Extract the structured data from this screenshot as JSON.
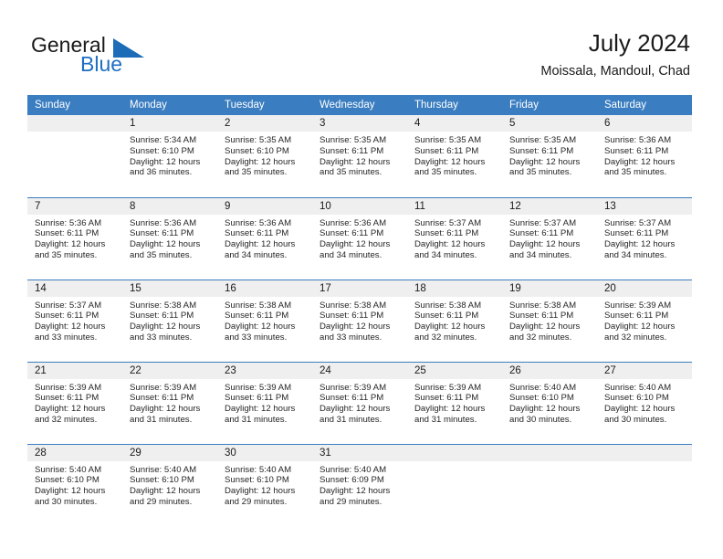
{
  "brand": {
    "name_line1": "General",
    "name_line2": "Blue",
    "triangle_color": "#1c6cb8",
    "blue_color": "#1f6fc4"
  },
  "header": {
    "title": "July 2024",
    "subtitle": "Moissala, Mandoul, Chad"
  },
  "theme": {
    "header_row_bg": "#3a7dc0",
    "daynum_bg": "#efefef",
    "row_divider": "#3a7dc0"
  },
  "weekdays": [
    "Sunday",
    "Monday",
    "Tuesday",
    "Wednesday",
    "Thursday",
    "Friday",
    "Saturday"
  ],
  "weeks": [
    [
      {
        "day": "",
        "sunrise": "",
        "sunset": "",
        "daylight": "",
        "daylight2": ""
      },
      {
        "day": "1",
        "sunrise": "Sunrise: 5:34 AM",
        "sunset": "Sunset: 6:10 PM",
        "daylight": "Daylight: 12 hours",
        "daylight2": "and 36 minutes."
      },
      {
        "day": "2",
        "sunrise": "Sunrise: 5:35 AM",
        "sunset": "Sunset: 6:10 PM",
        "daylight": "Daylight: 12 hours",
        "daylight2": "and 35 minutes."
      },
      {
        "day": "3",
        "sunrise": "Sunrise: 5:35 AM",
        "sunset": "Sunset: 6:11 PM",
        "daylight": "Daylight: 12 hours",
        "daylight2": "and 35 minutes."
      },
      {
        "day": "4",
        "sunrise": "Sunrise: 5:35 AM",
        "sunset": "Sunset: 6:11 PM",
        "daylight": "Daylight: 12 hours",
        "daylight2": "and 35 minutes."
      },
      {
        "day": "5",
        "sunrise": "Sunrise: 5:35 AM",
        "sunset": "Sunset: 6:11 PM",
        "daylight": "Daylight: 12 hours",
        "daylight2": "and 35 minutes."
      },
      {
        "day": "6",
        "sunrise": "Sunrise: 5:36 AM",
        "sunset": "Sunset: 6:11 PM",
        "daylight": "Daylight: 12 hours",
        "daylight2": "and 35 minutes."
      }
    ],
    [
      {
        "day": "7",
        "sunrise": "Sunrise: 5:36 AM",
        "sunset": "Sunset: 6:11 PM",
        "daylight": "Daylight: 12 hours",
        "daylight2": "and 35 minutes."
      },
      {
        "day": "8",
        "sunrise": "Sunrise: 5:36 AM",
        "sunset": "Sunset: 6:11 PM",
        "daylight": "Daylight: 12 hours",
        "daylight2": "and 35 minutes."
      },
      {
        "day": "9",
        "sunrise": "Sunrise: 5:36 AM",
        "sunset": "Sunset: 6:11 PM",
        "daylight": "Daylight: 12 hours",
        "daylight2": "and 34 minutes."
      },
      {
        "day": "10",
        "sunrise": "Sunrise: 5:36 AM",
        "sunset": "Sunset: 6:11 PM",
        "daylight": "Daylight: 12 hours",
        "daylight2": "and 34 minutes."
      },
      {
        "day": "11",
        "sunrise": "Sunrise: 5:37 AM",
        "sunset": "Sunset: 6:11 PM",
        "daylight": "Daylight: 12 hours",
        "daylight2": "and 34 minutes."
      },
      {
        "day": "12",
        "sunrise": "Sunrise: 5:37 AM",
        "sunset": "Sunset: 6:11 PM",
        "daylight": "Daylight: 12 hours",
        "daylight2": "and 34 minutes."
      },
      {
        "day": "13",
        "sunrise": "Sunrise: 5:37 AM",
        "sunset": "Sunset: 6:11 PM",
        "daylight": "Daylight: 12 hours",
        "daylight2": "and 34 minutes."
      }
    ],
    [
      {
        "day": "14",
        "sunrise": "Sunrise: 5:37 AM",
        "sunset": "Sunset: 6:11 PM",
        "daylight": "Daylight: 12 hours",
        "daylight2": "and 33 minutes."
      },
      {
        "day": "15",
        "sunrise": "Sunrise: 5:38 AM",
        "sunset": "Sunset: 6:11 PM",
        "daylight": "Daylight: 12 hours",
        "daylight2": "and 33 minutes."
      },
      {
        "day": "16",
        "sunrise": "Sunrise: 5:38 AM",
        "sunset": "Sunset: 6:11 PM",
        "daylight": "Daylight: 12 hours",
        "daylight2": "and 33 minutes."
      },
      {
        "day": "17",
        "sunrise": "Sunrise: 5:38 AM",
        "sunset": "Sunset: 6:11 PM",
        "daylight": "Daylight: 12 hours",
        "daylight2": "and 33 minutes."
      },
      {
        "day": "18",
        "sunrise": "Sunrise: 5:38 AM",
        "sunset": "Sunset: 6:11 PM",
        "daylight": "Daylight: 12 hours",
        "daylight2": "and 32 minutes."
      },
      {
        "day": "19",
        "sunrise": "Sunrise: 5:38 AM",
        "sunset": "Sunset: 6:11 PM",
        "daylight": "Daylight: 12 hours",
        "daylight2": "and 32 minutes."
      },
      {
        "day": "20",
        "sunrise": "Sunrise: 5:39 AM",
        "sunset": "Sunset: 6:11 PM",
        "daylight": "Daylight: 12 hours",
        "daylight2": "and 32 minutes."
      }
    ],
    [
      {
        "day": "21",
        "sunrise": "Sunrise: 5:39 AM",
        "sunset": "Sunset: 6:11 PM",
        "daylight": "Daylight: 12 hours",
        "daylight2": "and 32 minutes."
      },
      {
        "day": "22",
        "sunrise": "Sunrise: 5:39 AM",
        "sunset": "Sunset: 6:11 PM",
        "daylight": "Daylight: 12 hours",
        "daylight2": "and 31 minutes."
      },
      {
        "day": "23",
        "sunrise": "Sunrise: 5:39 AM",
        "sunset": "Sunset: 6:11 PM",
        "daylight": "Daylight: 12 hours",
        "daylight2": "and 31 minutes."
      },
      {
        "day": "24",
        "sunrise": "Sunrise: 5:39 AM",
        "sunset": "Sunset: 6:11 PM",
        "daylight": "Daylight: 12 hours",
        "daylight2": "and 31 minutes."
      },
      {
        "day": "25",
        "sunrise": "Sunrise: 5:39 AM",
        "sunset": "Sunset: 6:11 PM",
        "daylight": "Daylight: 12 hours",
        "daylight2": "and 31 minutes."
      },
      {
        "day": "26",
        "sunrise": "Sunrise: 5:40 AM",
        "sunset": "Sunset: 6:10 PM",
        "daylight": "Daylight: 12 hours",
        "daylight2": "and 30 minutes."
      },
      {
        "day": "27",
        "sunrise": "Sunrise: 5:40 AM",
        "sunset": "Sunset: 6:10 PM",
        "daylight": "Daylight: 12 hours",
        "daylight2": "and 30 minutes."
      }
    ],
    [
      {
        "day": "28",
        "sunrise": "Sunrise: 5:40 AM",
        "sunset": "Sunset: 6:10 PM",
        "daylight": "Daylight: 12 hours",
        "daylight2": "and 30 minutes."
      },
      {
        "day": "29",
        "sunrise": "Sunrise: 5:40 AM",
        "sunset": "Sunset: 6:10 PM",
        "daylight": "Daylight: 12 hours",
        "daylight2": "and 29 minutes."
      },
      {
        "day": "30",
        "sunrise": "Sunrise: 5:40 AM",
        "sunset": "Sunset: 6:10 PM",
        "daylight": "Daylight: 12 hours",
        "daylight2": "and 29 minutes."
      },
      {
        "day": "31",
        "sunrise": "Sunrise: 5:40 AM",
        "sunset": "Sunset: 6:09 PM",
        "daylight": "Daylight: 12 hours",
        "daylight2": "and 29 minutes."
      },
      {
        "day": "",
        "sunrise": "",
        "sunset": "",
        "daylight": "",
        "daylight2": ""
      },
      {
        "day": "",
        "sunrise": "",
        "sunset": "",
        "daylight": "",
        "daylight2": ""
      },
      {
        "day": "",
        "sunrise": "",
        "sunset": "",
        "daylight": "",
        "daylight2": ""
      }
    ]
  ]
}
